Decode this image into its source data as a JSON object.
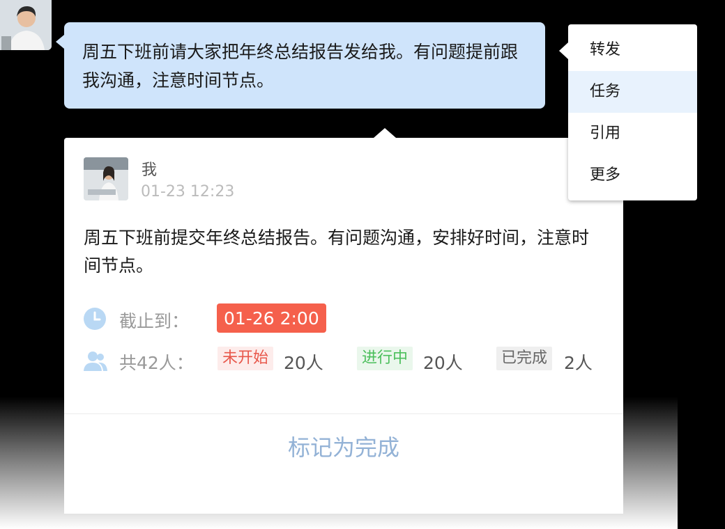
{
  "chat": {
    "message": "周五下班前请大家把年终总结报告发给我。有问题提前跟我沟通，注意时间节点。"
  },
  "context_menu": {
    "items": [
      {
        "label": "转发"
      },
      {
        "label": "任务"
      },
      {
        "label": "引用"
      },
      {
        "label": "更多"
      }
    ]
  },
  "task": {
    "sender": "我",
    "time": "01-23 12:23",
    "content": "周五下班前提交年终总结报告。有问题沟通，安排好时间，注意时间节点。",
    "deadline_label": "截止到：",
    "deadline_value": "01-26 2:00",
    "people_label": "共42人：",
    "statuses": [
      {
        "label": "未开始",
        "count": "20人"
      },
      {
        "label": "进行中",
        "count": "20人"
      },
      {
        "label": "已完成",
        "count": "2人"
      }
    ],
    "mark_done": "标记为完成"
  },
  "colors": {
    "bubble": "#cfe4fb",
    "deadline_badge": "#f5604c",
    "not_started": "#e8574a",
    "in_progress": "#4bbf5b",
    "done": "#666666",
    "mark_done": "#93b2d6"
  },
  "icons": [
    "clock-icon",
    "people-icon"
  ]
}
